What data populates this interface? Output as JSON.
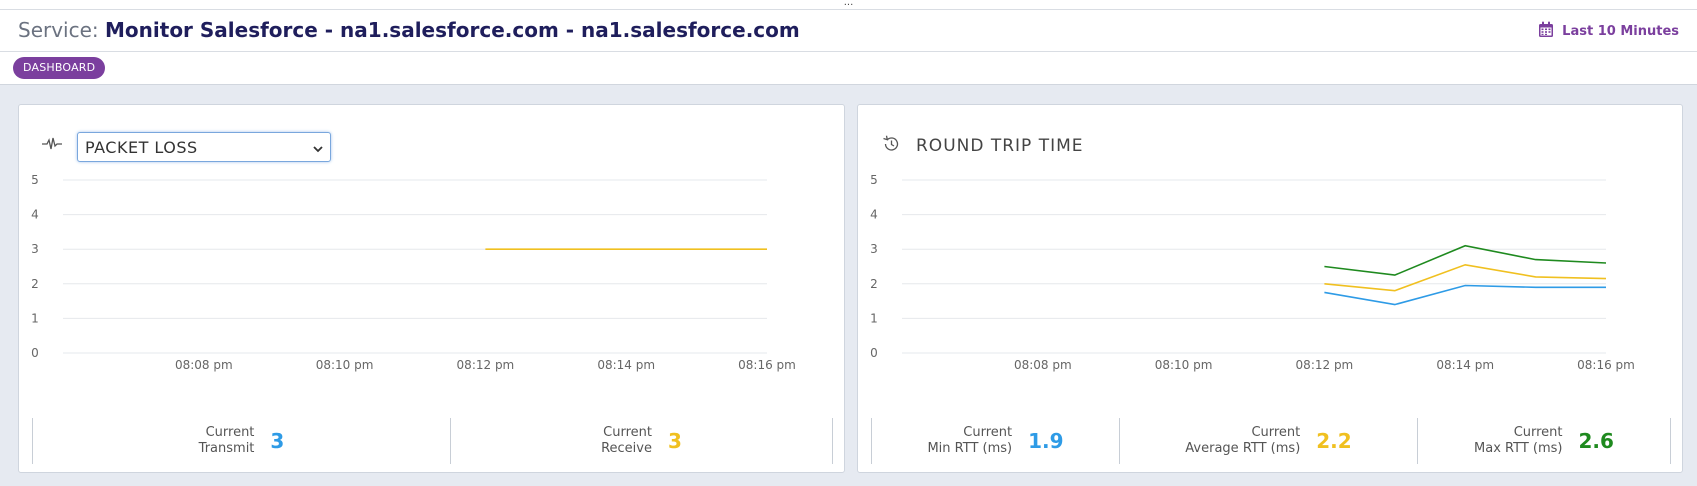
{
  "top_strip": {
    "text": "..."
  },
  "header": {
    "service_prefix": "Service:",
    "service_name": "Monitor Salesforce - na1.salesforce.com - na1.salesforce.com",
    "time_range": "Last 10 Minutes"
  },
  "subnav": {
    "dashboard_label": "DASHBOARD"
  },
  "colors": {
    "accent": "#7b3f9e",
    "title": "#1f1e5c",
    "blue": "#2e9be6",
    "yellow": "#f0c020",
    "green": "#1f8a1f"
  },
  "packet_loss": {
    "selected_metric": "PACKET LOSS",
    "stats": [
      {
        "label_line1": "Current",
        "label_line2": "Transmit",
        "value": "3",
        "color": "#2e9be6"
      },
      {
        "label_line1": "Current",
        "label_line2": "Receive",
        "value": "3",
        "color": "#f0c020"
      }
    ]
  },
  "round_trip_time": {
    "title": "ROUND TRIP TIME",
    "stats": [
      {
        "label_line1": "Current",
        "label_line2": "Min RTT (ms)",
        "value": "1.9",
        "color": "#2e9be6"
      },
      {
        "label_line1": "Current",
        "label_line2": "Average RTT (ms)",
        "value": "2.2",
        "color": "#f0c020"
      },
      {
        "label_line1": "Current",
        "label_line2": "Max RTT (ms)",
        "value": "2.6",
        "color": "#1f8a1f"
      }
    ]
  },
  "chart_data": [
    {
      "type": "line",
      "x_tick_labels": [
        "08:08 pm",
        "08:10 pm",
        "08:12 pm",
        "08:14 pm",
        "08:16 pm"
      ],
      "y_ticks": [
        0,
        1,
        2,
        3,
        4,
        5
      ],
      "ylim": [
        0,
        5
      ],
      "xlim": [
        "08:06 pm",
        "08:16 pm"
      ],
      "grid": true,
      "series": [
        {
          "color": "#f0c020",
          "x": [
            "08:12 pm",
            "08:16 pm"
          ],
          "y": [
            3,
            3
          ]
        }
      ]
    },
    {
      "type": "line",
      "x_tick_labels": [
        "08:08 pm",
        "08:10 pm",
        "08:12 pm",
        "08:14 pm",
        "08:16 pm"
      ],
      "y_ticks": [
        0,
        1,
        2,
        3,
        4,
        5
      ],
      "ylim": [
        0,
        5
      ],
      "xlim": [
        "08:06 pm",
        "08:16 pm"
      ],
      "grid": true,
      "series": [
        {
          "color": "#1f8a1f",
          "x": [
            "08:12 pm",
            "08:13 pm",
            "08:14 pm",
            "08:15 pm",
            "08:16 pm"
          ],
          "y": [
            2.5,
            2.25,
            3.1,
            2.7,
            2.6
          ]
        },
        {
          "color": "#f0c020",
          "x": [
            "08:12 pm",
            "08:13 pm",
            "08:14 pm",
            "08:15 pm",
            "08:16 pm"
          ],
          "y": [
            2.0,
            1.8,
            2.55,
            2.2,
            2.15
          ]
        },
        {
          "color": "#2e9be6",
          "x": [
            "08:12 pm",
            "08:13 pm",
            "08:14 pm",
            "08:15 pm",
            "08:16 pm"
          ],
          "y": [
            1.75,
            1.4,
            1.95,
            1.9,
            1.9
          ]
        }
      ]
    }
  ]
}
